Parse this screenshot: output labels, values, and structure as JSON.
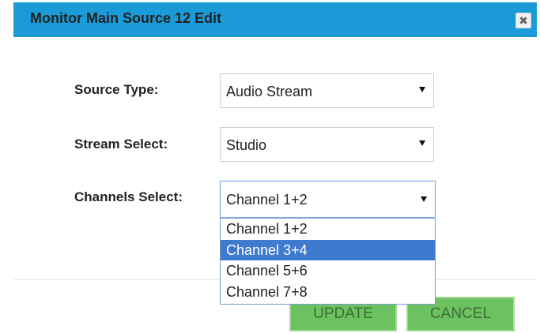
{
  "dialog": {
    "title": "Monitor Main Source 12 Edit",
    "close_icon": "close-icon",
    "close_glyph": "✖"
  },
  "form": {
    "source_type": {
      "label": "Source Type:",
      "value": "Audio Stream"
    },
    "stream_select": {
      "label": "Stream Select:",
      "value": "Studio"
    },
    "channels_select": {
      "label": "Channels Select:",
      "value": "Channel 1+2",
      "options": [
        "Channel 1+2",
        "Channel 3+4",
        "Channel 5+6",
        "Channel 7+8"
      ],
      "highlighted_option": "Channel 3+4"
    }
  },
  "buttons": {
    "update_label": "UPDATE",
    "cancel_label": "CANCEL"
  },
  "colors": {
    "header": "#1a9bd7",
    "button_green": "#6cc160",
    "option_highlight": "#3f7ad1"
  }
}
